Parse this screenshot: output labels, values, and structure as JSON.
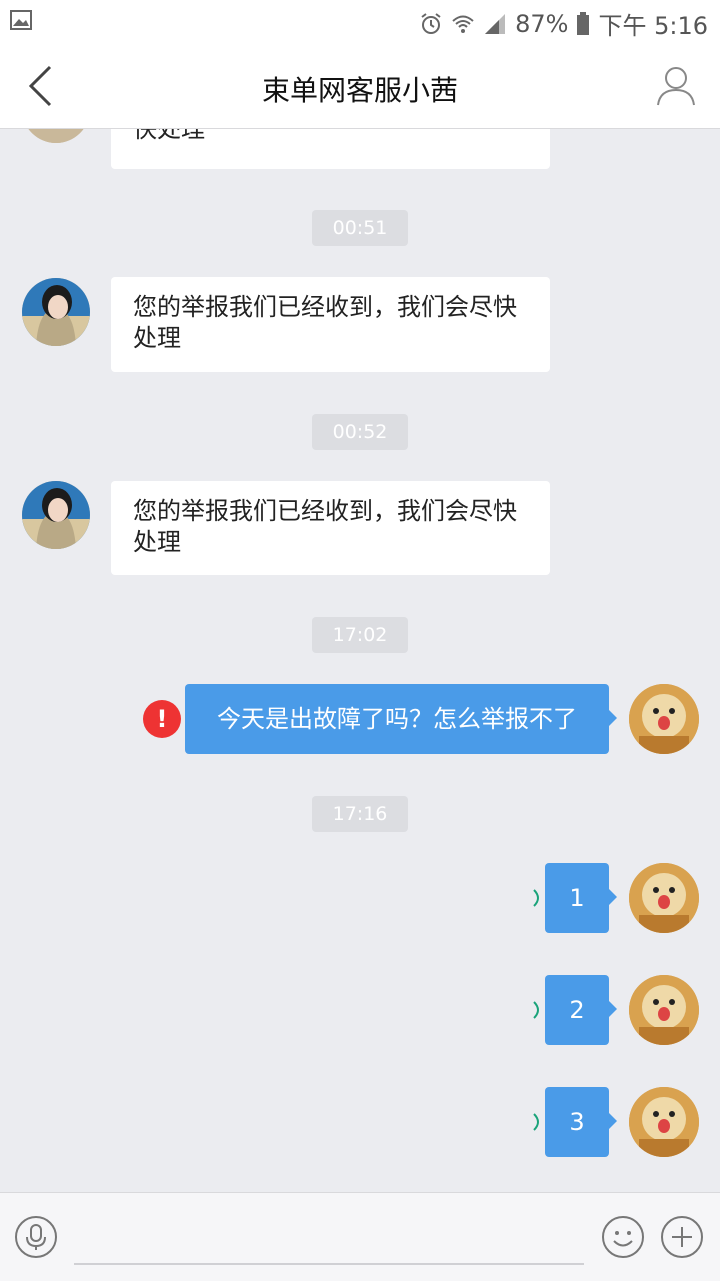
{
  "status_bar": {
    "battery": "87%",
    "time": "下午 5:16"
  },
  "header": {
    "title": "束单网客服小茜"
  },
  "messages": {
    "partial": "快处理",
    "ts1": "00:51",
    "msg1": "您的举报我们已经收到，我们会尽快处理",
    "ts2": "00:52",
    "msg2": "您的举报我们已经收到，我们会尽快处理",
    "ts3": "17:02",
    "error_mark": "!",
    "msg3": "今天是出故障了吗？怎么举报不了",
    "ts4": "17:16",
    "msg4": "1",
    "msg5": "2",
    "msg6": "3"
  },
  "colors": {
    "bubble_sent": "#4a9be8",
    "background": "#ebecf0",
    "error": "#ee3333"
  },
  "icons": [
    "gallery-icon",
    "alarm-icon",
    "wifi-icon",
    "signal-icon",
    "battery-icon",
    "back-icon",
    "profile-icon",
    "mic-icon",
    "emoji-icon",
    "plus-icon"
  ]
}
